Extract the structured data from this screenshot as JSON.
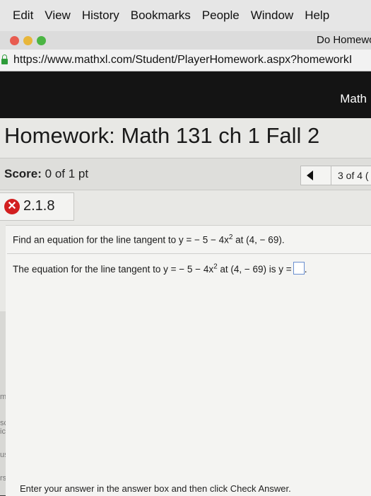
{
  "menubar": {
    "items": [
      "Edit",
      "View",
      "History",
      "Bookmarks",
      "People",
      "Window",
      "Help"
    ]
  },
  "tab": {
    "title": "Do Homewo"
  },
  "url": {
    "value": "https://www.mathxl.com/Student/PlayerHomework.aspx?homeworkI"
  },
  "header": {
    "math_link": "Math"
  },
  "homework": {
    "title": "Homework: Math 131 ch 1 Fall 2",
    "score_label": "Score:",
    "score_value": "0 of 1 pt",
    "nav_count": "3 of 4 ("
  },
  "question": {
    "number": "2.1.8",
    "status_icon": "x-icon",
    "prompt_pre": "Find an equation for the line tangent to y = − 5 − 4x",
    "prompt_exp": "2",
    "prompt_post": " at (4, − 69).",
    "answer_pre": "The equation for the line tangent to y = − 5 − 4x",
    "answer_exp": "2",
    "answer_post": " at (4, − 69) is y =",
    "answer_value": "",
    "answer_suffix": ".",
    "instructions": "Enter your answer in the answer box and then click Check Answer."
  },
  "left_edge": {
    "fragments": [
      "m",
      "sc",
      "ic",
      "us",
      "rs"
    ]
  },
  "colors": {
    "accent_error": "#d21f1f",
    "secure_lock": "#2e9c3a",
    "answer_box_border": "#6a8fd0",
    "header_band": "#141414"
  }
}
